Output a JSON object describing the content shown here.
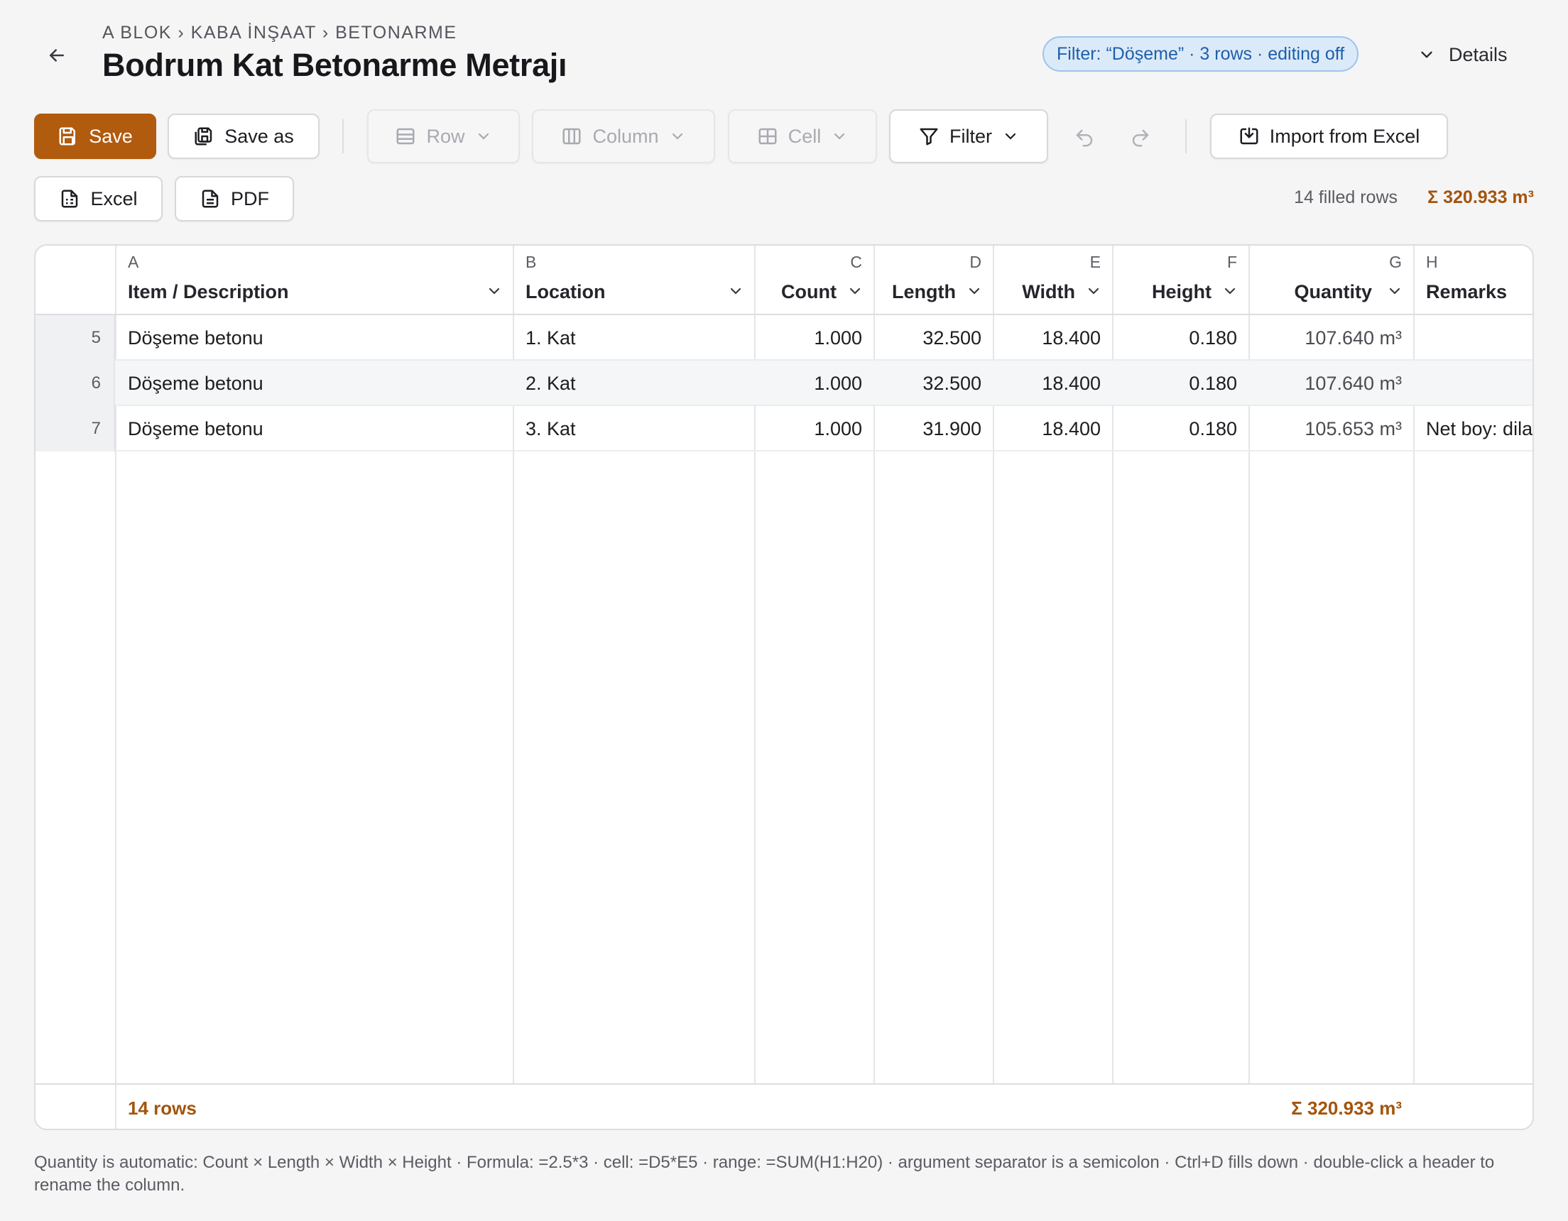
{
  "header": {
    "breadcrumb": "A BLOK › KABA İNŞAAT › BETONARME",
    "title": "Bodrum Kat Betonarme Metrajı",
    "filter_badge": "Filter: “Döşeme” · 3 rows · editing off",
    "details_label": "Details"
  },
  "toolbar": {
    "save": "Save",
    "save_as": "Save as",
    "row": "Row",
    "column": "Column",
    "cell": "Cell",
    "filter": "Filter",
    "import": "Import from Excel",
    "excel": "Excel",
    "pdf": "PDF"
  },
  "summary": {
    "filled_rows": "14 filled rows",
    "total": "Σ 320.933 m³"
  },
  "columns": [
    {
      "letter": "A",
      "name": "Item / Description"
    },
    {
      "letter": "B",
      "name": "Location"
    },
    {
      "letter": "C",
      "name": "Count"
    },
    {
      "letter": "D",
      "name": "Length"
    },
    {
      "letter": "E",
      "name": "Width"
    },
    {
      "letter": "F",
      "name": "Height"
    },
    {
      "letter": "G",
      "name": "Quantity"
    },
    {
      "letter": "H",
      "name": "Remarks"
    }
  ],
  "rows": [
    {
      "num": "5",
      "item": "Döşeme betonu",
      "location": "1. Kat",
      "count": "1.000",
      "length": "32.500",
      "width": "18.400",
      "height": "0.180",
      "quantity": "107.640 m³",
      "remarks": ""
    },
    {
      "num": "6",
      "item": "Döşeme betonu",
      "location": "2. Kat",
      "count": "1.000",
      "length": "32.500",
      "width": "18.400",
      "height": "0.180",
      "quantity": "107.640 m³",
      "remarks": ""
    },
    {
      "num": "7",
      "item": "Döşeme betonu",
      "location": "3. Kat",
      "count": "1.000",
      "length": "31.900",
      "width": "18.400",
      "height": "0.180",
      "quantity": "105.653 m³",
      "remarks": "Net boy: dila"
    }
  ],
  "footer": {
    "rows": "14 rows",
    "total": "Σ 320.933 m³"
  },
  "help_text": "Quantity is automatic: Count × Length × Width × Height · Formula: =2.5*3 · cell: =D5*E5 · range: =SUM(H1:H20) · argument separator is a semicolon · Ctrl+D fills down · double-click a header to rename the column.",
  "colors": {
    "accent": "#b15b0e",
    "total_text": "#a3540c",
    "badge_bg": "#dbeaf9",
    "badge_text": "#1f5fa8"
  }
}
